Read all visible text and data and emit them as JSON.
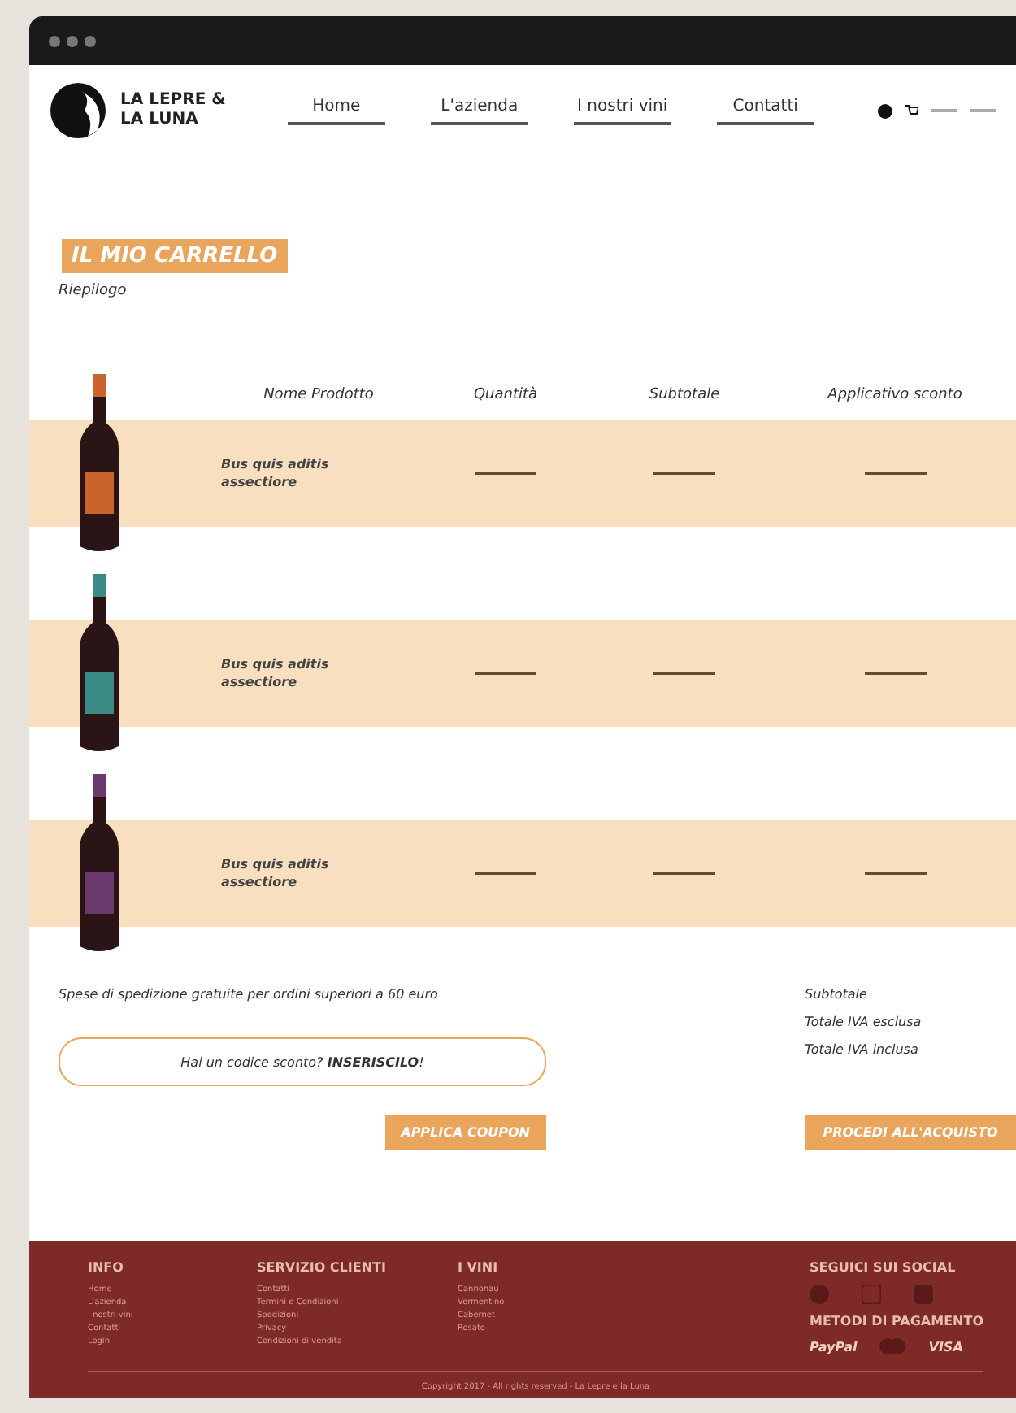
{
  "brand": {
    "line_1": "LA LEPRE &",
    "line_2": "LA LUNA"
  },
  "nav": [
    {
      "label": "Home"
    },
    {
      "label": "L'azienda"
    },
    {
      "label": "I nostri vini"
    },
    {
      "label": "Contatti"
    }
  ],
  "cart": {
    "title": "IL MIO CARRELLO",
    "subtitle": "Riepilogo",
    "columns": [
      "Nome Prodotto",
      "Quantità",
      "Subtotale",
      "Applicativo sconto"
    ],
    "rows": [
      {
        "name": "Bus quis aditis\nassectiore",
        "color": "#c8642c"
      },
      {
        "name": "Bus quis aditis\nassectiore",
        "color": "#3a8a86"
      },
      {
        "name": "Bus quis aditis\nassectiore",
        "color": "#6a3a6e"
      }
    ]
  },
  "shipping_note": "Spese di spedizione gratuite per ordini superiori a 60 euro",
  "coupon": {
    "placeholder": "Hai un codice sconto? **INSERISCILO**!",
    "button": "APPLICA COUPON"
  },
  "totals": [
    "Subtotale",
    "Totale IVA esclusa",
    "Totale IVA inclusa"
  ],
  "checkout_button": "PROCEDI ALL'ACQUISTO",
  "footer": {
    "columns": [
      {
        "title": "INFO",
        "links": [
          "Home",
          "L'azienda",
          "I nostri vini",
          "Contatti",
          "Login"
        ]
      },
      {
        "title": "SERVIZIO CLIENTI",
        "links": [
          "Contatti",
          "Termini e Condizioni",
          "Spedizioni",
          "Privacy",
          "Condizioni di vendita"
        ]
      },
      {
        "title": "I VINI",
        "links": [
          "Cannonau",
          "Vermentino",
          "Cabernet",
          "Rosato"
        ]
      }
    ],
    "social_title": "SEGUICI SUI SOCIAL",
    "payment_title": "METODI DI PAGAMENTO",
    "payments": [
      "PayPal",
      "VISA"
    ],
    "copyright": "Copyright 2017 - All rights reserved - La Lepre e la Luna"
  }
}
